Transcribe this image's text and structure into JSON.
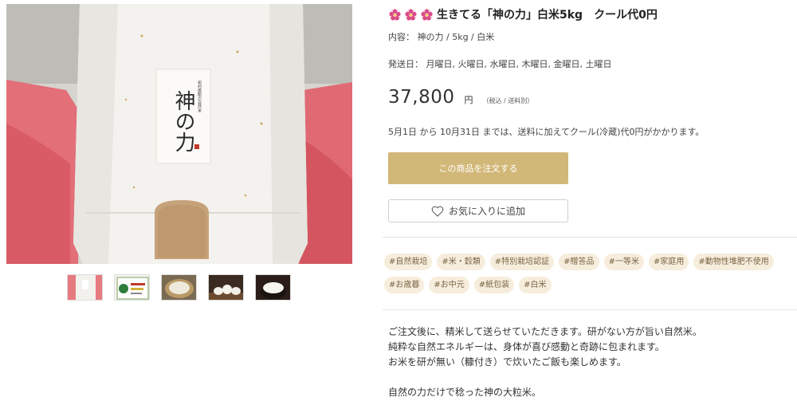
{
  "product": {
    "title": "生きてる「神の力」白米5kg　クール代0円",
    "flower_icon_color": "#d94a86",
    "package_label_small": "祝村農配の自然米",
    "package_label_main": "神の力",
    "contents_label": "内容：",
    "contents_value": "神の力 / 5kg / 白米",
    "ship_days_label": "発送日：",
    "ship_days_value": "月曜日, 火曜日, 水曜日, 木曜日, 金曜日, 土曜日",
    "price": "37,800",
    "currency": "円",
    "price_note": "（税込 / 送料別）",
    "cool_notice": "5月1日 から 10月31日 までは、送料に加えてクール(冷蔵)代0円がかかります。"
  },
  "actions": {
    "order_label": "この商品を注文する",
    "favorite_label": "お気に入りに追加"
  },
  "tags": [
    "#自然栽培",
    "#米・穀類",
    "#特別栽培認証",
    "#贈答品",
    "#一等米",
    "#家庭用",
    "#動物性堆肥不使用",
    "#お歳暮",
    "#お中元",
    "#紙包装",
    "#白米"
  ],
  "description": [
    "ご注文後に、精米して送らせていただきます。研がない方が旨い自然米。",
    "純粋な自然エネルギーは、身体が喜び感動と奇跡に包まれます。",
    "お米を研が無い（糠付き）で炊いたご飯も楽しめます。",
    "",
    "自然の力だけで稔った神の大粒米。"
  ],
  "colors": {
    "order_button": "#d2b878",
    "tag_background": "#f7eddc",
    "tag_text": "#7a6646"
  }
}
